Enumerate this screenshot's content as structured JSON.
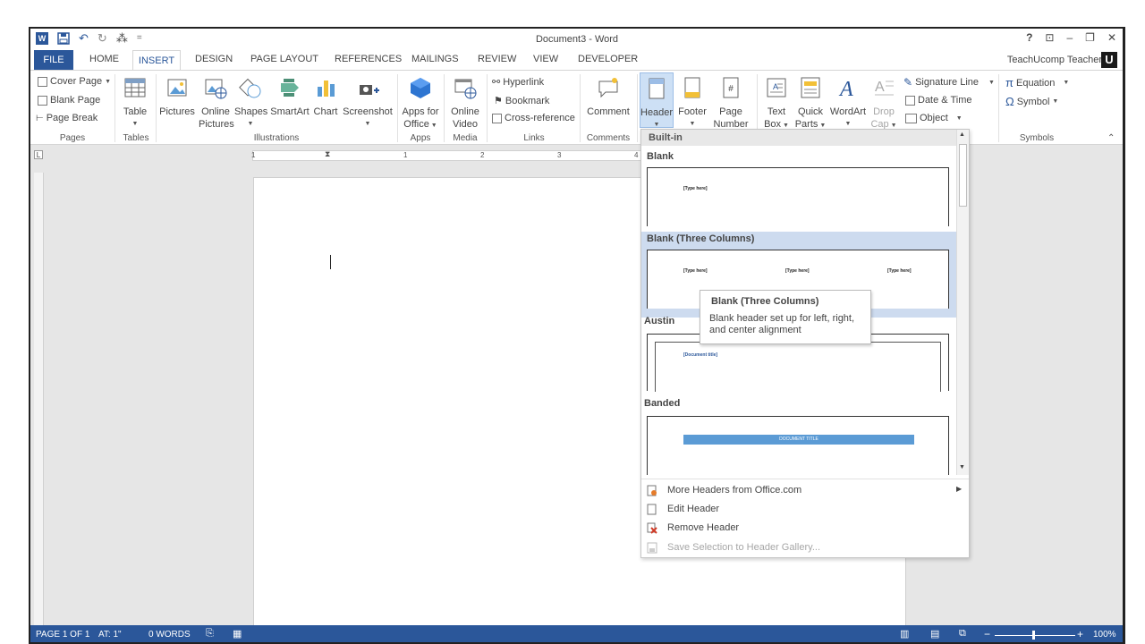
{
  "window": {
    "title": "Document3 - Word",
    "help": "?",
    "restore_ribbon": "⊡",
    "minimize": "–",
    "maximize": "❐",
    "close": "✕"
  },
  "qat": {
    "app_icon": "W",
    "save": "💾",
    "undo": "↶",
    "redo": "↻",
    "touch": "⁂",
    "customize": "="
  },
  "tabs": [
    "FILE",
    "HOME",
    "INSERT",
    "DESIGN",
    "PAGE LAYOUT",
    "REFERENCES",
    "MAILINGS",
    "REVIEW",
    "VIEW",
    "DEVELOPER"
  ],
  "account": {
    "user": "TeachUcomp Teacher",
    "logo": "U"
  },
  "ribbon": {
    "pages": {
      "cover_page": "Cover Page",
      "blank_page": "Blank Page",
      "page_break": "Page Break",
      "label": "Pages"
    },
    "tables": {
      "table": "Table",
      "label": "Tables"
    },
    "illustrations": {
      "pictures": "Pictures",
      "online_pictures_1": "Online",
      "online_pictures_2": "Pictures",
      "shapes": "Shapes",
      "smartart": "SmartArt",
      "chart": "Chart",
      "screenshot": "Screenshot",
      "label": "Illustrations"
    },
    "apps": {
      "apps_1": "Apps for",
      "apps_2": "Office",
      "label": "Apps"
    },
    "media": {
      "video_1": "Online",
      "video_2": "Video",
      "label": "Media"
    },
    "links": {
      "hyperlink": "Hyperlink",
      "bookmark": "Bookmark",
      "cross_reference": "Cross-reference",
      "label": "Links"
    },
    "comments": {
      "comment": "Comment",
      "label": "Comments"
    },
    "header_footer": {
      "header": "Header",
      "footer": "Footer",
      "page_number_1": "Page",
      "page_number_2": "Number"
    },
    "text": {
      "text_box_1": "Text",
      "text_box_2": "Box",
      "quick_parts_1": "Quick",
      "quick_parts_2": "Parts",
      "wordart": "WordArt",
      "drop_cap_1": "Drop",
      "drop_cap_2": "Cap",
      "signature_line": "Signature Line",
      "date_time": "Date & Time",
      "object": "Object"
    },
    "symbols": {
      "equation": "Equation",
      "symbol": "Symbol",
      "label": "Symbols"
    }
  },
  "ruler": {
    "marks": [
      "1",
      "1",
      "2",
      "3",
      "4"
    ]
  },
  "gallery": {
    "heading": "Built-in",
    "sections": [
      {
        "name": "Blank",
        "texts": [
          "[Type here]"
        ]
      },
      {
        "name": "Blank (Three Columns)",
        "texts": [
          "[Type here]",
          "[Type here]",
          "[Type here]"
        ]
      },
      {
        "name": "Austin",
        "texts": [
          "[Document title]"
        ]
      },
      {
        "name": "Banded",
        "texts": [
          "DOCUMENT TITLE"
        ]
      }
    ],
    "menu": [
      {
        "label": "More Headers from Office.com",
        "icon": "globe-doc-icon",
        "disabled": false
      },
      {
        "label": "Edit Header",
        "icon": "page-icon",
        "disabled": false
      },
      {
        "label": "Remove Header",
        "icon": "remove-header-icon",
        "disabled": false
      },
      {
        "label": "Save Selection to Header Gallery...",
        "icon": "save-selection-icon",
        "disabled": true
      }
    ]
  },
  "tooltip": {
    "title": "Blank (Three Columns)",
    "body": "Blank header set up for left, right, and center alignment"
  },
  "status": {
    "page": "PAGE 1 OF 1",
    "at": "AT: 1\"",
    "words": "0 WORDS",
    "zoom": "100%",
    "zoom_level": 1.0
  },
  "colors": {
    "accent": "#2b579a",
    "ribbon_bg": "#ffffff",
    "workspace": "#e6e6e6",
    "gallery_highlight": "#cddbef"
  }
}
